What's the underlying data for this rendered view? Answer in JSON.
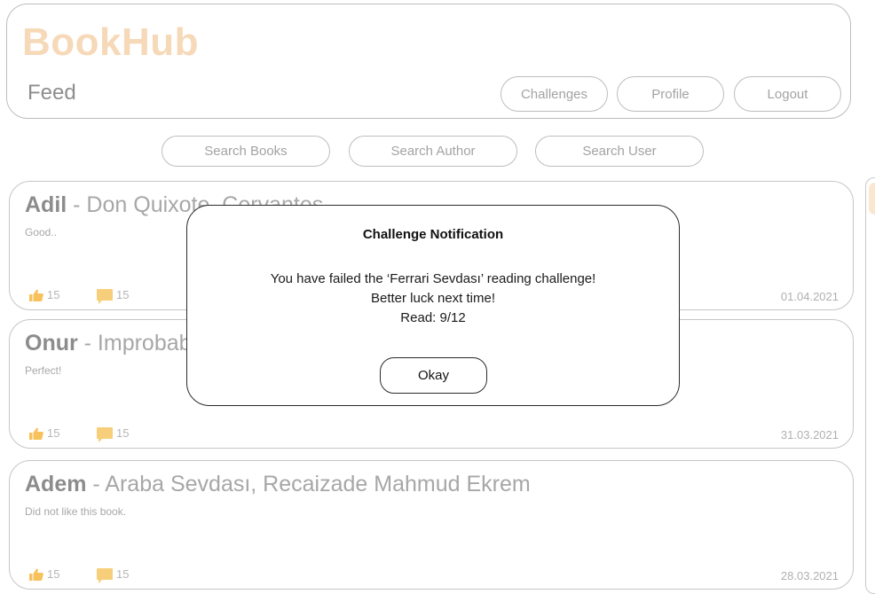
{
  "header": {
    "logo": "BookHub",
    "page_title": "Feed",
    "nav": {
      "challenges": "Challenges",
      "profile": "Profile",
      "logout": "Logout"
    }
  },
  "search": {
    "books": "Search Books",
    "author": "Search Author",
    "user": "Search User"
  },
  "posts": [
    {
      "user": "Adil",
      "book": " - Don Quixote, Cervantes",
      "body": "Good..",
      "likes": "15",
      "comments": "15",
      "date": "01.04.2021"
    },
    {
      "user": "Onur",
      "book": " - Improbable",
      "body": "Perfect!",
      "likes": "15",
      "comments": "15",
      "date": "31.03.2021"
    },
    {
      "user": "Adem",
      "book": " - Araba Sevdası, Recaizade Mahmud Ekrem",
      "body": "Did not like this book.",
      "likes": "15",
      "comments": "15",
      "date": "28.03.2021"
    }
  ],
  "modal": {
    "title": "Challenge Notification",
    "line1": "You have failed the ‘Ferrari Sevdası’ reading challenge!",
    "line2": "Better luck next time!",
    "line3": "Read: 9/12",
    "ok_label": "Okay"
  },
  "icons": {
    "like": "thumbs-up-icon",
    "comment": "comment-icon"
  },
  "colors": {
    "brand": "#f6d9b8",
    "like": "#f7c15c",
    "comment": "#f7cf7a"
  }
}
